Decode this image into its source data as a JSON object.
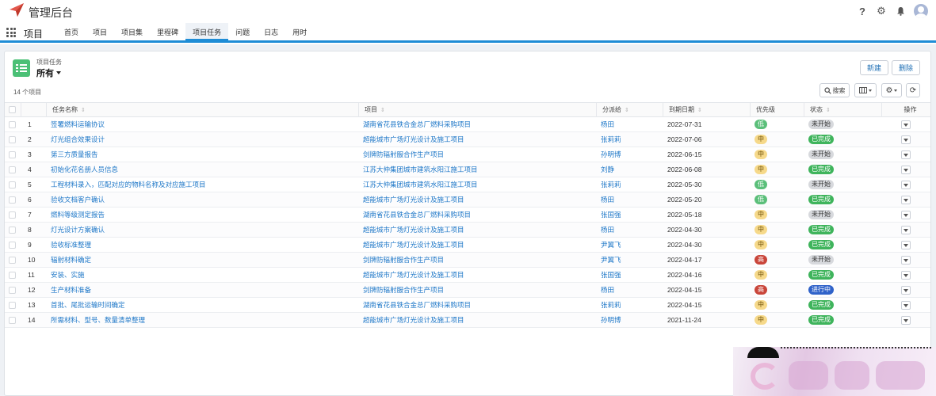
{
  "app": {
    "title": "管理后台"
  },
  "header_icons": [
    "help-icon",
    "gear-icon",
    "bell-icon",
    "avatar"
  ],
  "nav": {
    "app_name": "项目",
    "tabs": [
      "首页",
      "项目",
      "项目集",
      "里程碑",
      "项目任务",
      "问题",
      "日志",
      "用时"
    ],
    "active_tab": "项目任务"
  },
  "list_view": {
    "object_label": "项目任务",
    "view_name": "所有",
    "count_text": "14 个项目",
    "new_button": "新建",
    "delete_button": "删除",
    "search_button": "搜索"
  },
  "table": {
    "columns": {
      "name": "任务名称",
      "project": "项目",
      "assignee": "分派给",
      "due": "到期日期",
      "priority": "优先级",
      "status": "状态",
      "action": "操作"
    },
    "rows": [
      {
        "num": "1",
        "name": "签署燃料运输协议",
        "project": "湖南省花县铁合金总厂燃料采购项目",
        "assignee": "杨田",
        "due": "2022-07-31",
        "priority": "低",
        "status": "未开始"
      },
      {
        "num": "2",
        "name": "灯光组合效果设计",
        "project": "超能城市广场灯光设计及施工项目",
        "assignee": "张莉莉",
        "due": "2022-07-06",
        "priority": "中",
        "status": "已完成"
      },
      {
        "num": "3",
        "name": "第三方质量报告",
        "project": "剑牌防辐射服合作生产项目",
        "assignee": "孙明博",
        "due": "2022-06-15",
        "priority": "中",
        "status": "未开始"
      },
      {
        "num": "4",
        "name": "初始化花名册人员信息",
        "project": "江苏大仲集团城市建筑水阳江施工项目",
        "assignee": "刘静",
        "due": "2022-06-08",
        "priority": "中",
        "status": "已完成"
      },
      {
        "num": "5",
        "name": "工程材料录入，匹配对应的物料名称及对应施工项目",
        "project": "江苏大仲集团城市建筑水阳江施工项目",
        "assignee": "张莉莉",
        "due": "2022-05-30",
        "priority": "低",
        "status": "未开始"
      },
      {
        "num": "6",
        "name": "验收文档客户确认",
        "project": "超能城市广场灯光设计及施工项目",
        "assignee": "杨田",
        "due": "2022-05-20",
        "priority": "低",
        "status": "已完成"
      },
      {
        "num": "7",
        "name": "燃料等级测定报告",
        "project": "湖南省花县铁合金总厂燃料采购项目",
        "assignee": "张国强",
        "due": "2022-05-18",
        "priority": "中",
        "status": "未开始"
      },
      {
        "num": "8",
        "name": "灯光设计方案确认",
        "project": "超能城市广场灯光设计及施工项目",
        "assignee": "杨田",
        "due": "2022-04-30",
        "priority": "中",
        "status": "已完成"
      },
      {
        "num": "9",
        "name": "验收标准整理",
        "project": "超能城市广场灯光设计及施工项目",
        "assignee": "尹翼飞",
        "due": "2022-04-30",
        "priority": "中",
        "status": "已完成"
      },
      {
        "num": "10",
        "name": "辐射材料确定",
        "project": "剑牌防辐射服合作生产项目",
        "assignee": "尹翼飞",
        "due": "2022-04-17",
        "priority": "高",
        "status": "未开始"
      },
      {
        "num": "11",
        "name": "安装、实施",
        "project": "超能城市广场灯光设计及施工项目",
        "assignee": "张国强",
        "due": "2022-04-16",
        "priority": "中",
        "status": "已完成"
      },
      {
        "num": "12",
        "name": "生产材料准备",
        "project": "剑牌防辐射服合作生产项目",
        "assignee": "杨田",
        "due": "2022-04-15",
        "priority": "高",
        "status": "进行中"
      },
      {
        "num": "13",
        "name": "首批、尾批运输时间确定",
        "project": "湖南省花县铁合金总厂燃料采购项目",
        "assignee": "张莉莉",
        "due": "2022-04-15",
        "priority": "中",
        "status": "已完成"
      },
      {
        "num": "14",
        "name": "所需材料、型号、数量清单整理",
        "project": "超能城市广场灯光设计及施工项目",
        "assignee": "孙明博",
        "due": "2021-11-24",
        "priority": "中",
        "status": "已完成"
      }
    ]
  },
  "colors": {
    "accent": "#1f8dd6",
    "link": "#1f78c8",
    "priority_low": "#5bbf7a",
    "priority_mid": "#f6d98a",
    "priority_high": "#c9453a",
    "status_done": "#3fb45c",
    "status_notstart": "#d7d9dd",
    "status_progress": "#2f62c9"
  }
}
